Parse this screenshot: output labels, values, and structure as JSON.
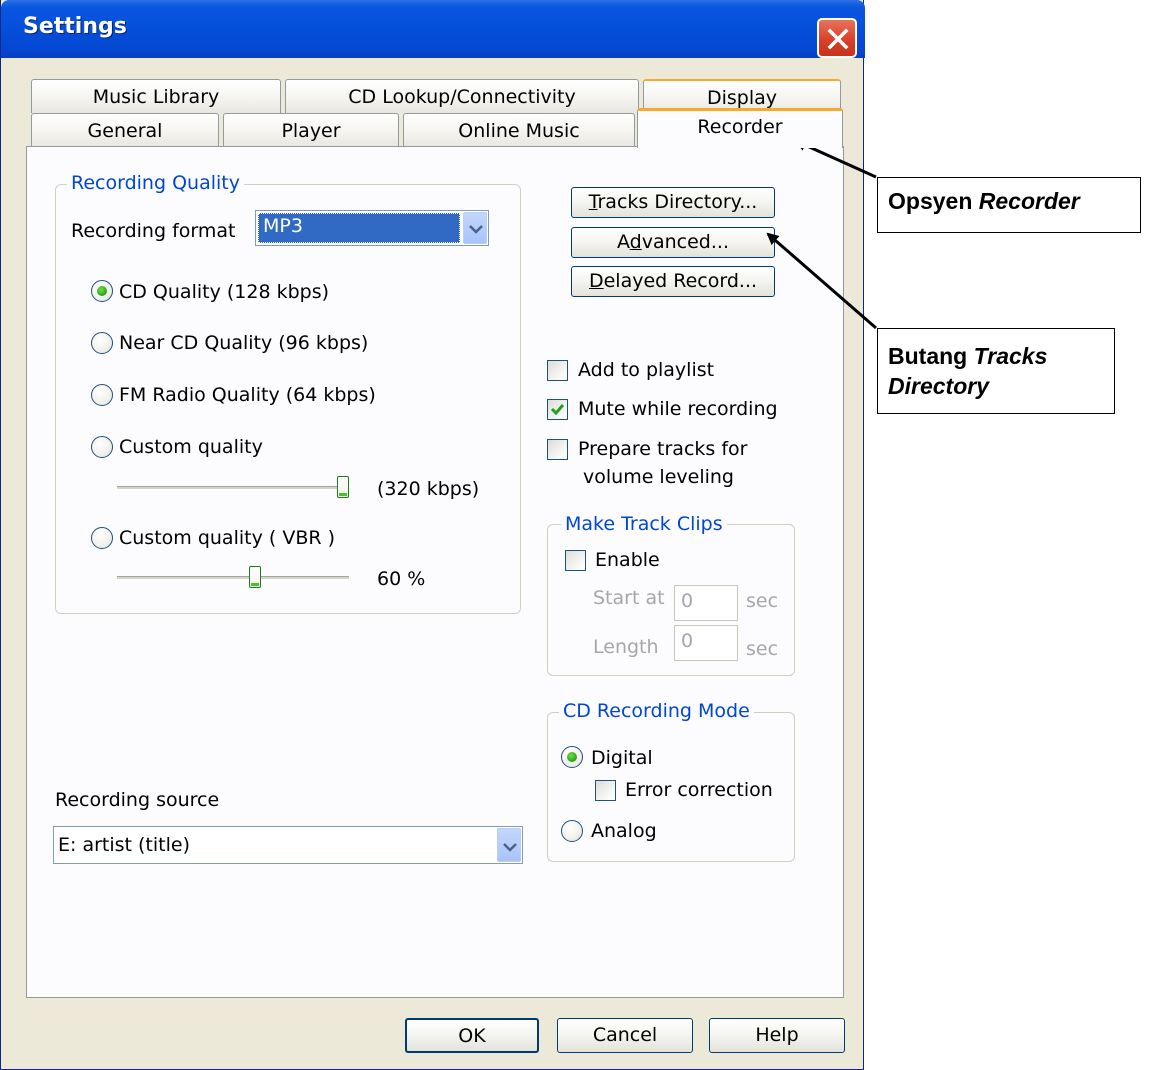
{
  "window": {
    "title": "Settings"
  },
  "tabs": {
    "row1": [
      "Music Library",
      "CD Lookup/Connectivity",
      "Display"
    ],
    "row2": [
      "General",
      "Player",
      "Online Music",
      "Recorder"
    ],
    "active": "Recorder"
  },
  "recording_quality": {
    "title": "Recording Quality",
    "format_label": "Recording format",
    "format_value": "MP3",
    "options": [
      "CD Quality (128 kbps)",
      "Near CD Quality (96 kbps)",
      "FM Radio Quality (64 kbps)",
      "Custom quality",
      "Custom quality ( VBR )"
    ],
    "selected_option": "CD Quality (128 kbps)",
    "custom_value": "(320 kbps)",
    "custom_slider_level": 1.0,
    "vbr_value": "60 %",
    "vbr_slider_level": 0.6
  },
  "buttons": {
    "tracks_directory": {
      "underline": "T",
      "rest": "racks Directory..."
    },
    "advanced": {
      "pre": "A",
      "underline": "d",
      "rest": "vanced..."
    },
    "delayed_record": {
      "underline": "D",
      "rest": "elayed Record..."
    }
  },
  "options": {
    "add_to_playlist": "Add to playlist",
    "add_to_playlist_checked": false,
    "mute_while_recording": "Mute while recording",
    "mute_while_recording_checked": true,
    "prepare_tracks_line1": "Prepare tracks for",
    "prepare_tracks_line2": "volume leveling",
    "prepare_tracks_checked": false
  },
  "track_clips": {
    "title": "Make Track Clips",
    "enable_label": "Enable",
    "enable_checked": false,
    "start_label": "Start at",
    "start_value": "0",
    "start_unit": "sec",
    "length_label": "Length",
    "length_value": "0",
    "length_unit": "sec"
  },
  "cd_mode": {
    "title": "CD Recording Mode",
    "digital": "Digital",
    "error_correction": "Error correction",
    "error_correction_checked": false,
    "analog": "Analog",
    "selected": "Digital"
  },
  "source": {
    "label": "Recording source",
    "value": "E: artist (title)"
  },
  "footer": {
    "ok": "OK",
    "cancel": "Cancel",
    "help": "Help"
  },
  "annotations": {
    "recorder_prefix": "Opsyen ",
    "recorder_italic": "Recorder",
    "tracks_prefix": "Butang ",
    "tracks_italic_line1": "Tracks",
    "tracks_italic_line2": "Directory"
  },
  "colors": {
    "title_bar": "#0550dc",
    "dialog_bg": "#ece9d8",
    "tab_highlight": "#f8a92b",
    "groupbox_title": "#0046d5",
    "radio_dot": "#27a50f",
    "selection": "#316ac5"
  }
}
